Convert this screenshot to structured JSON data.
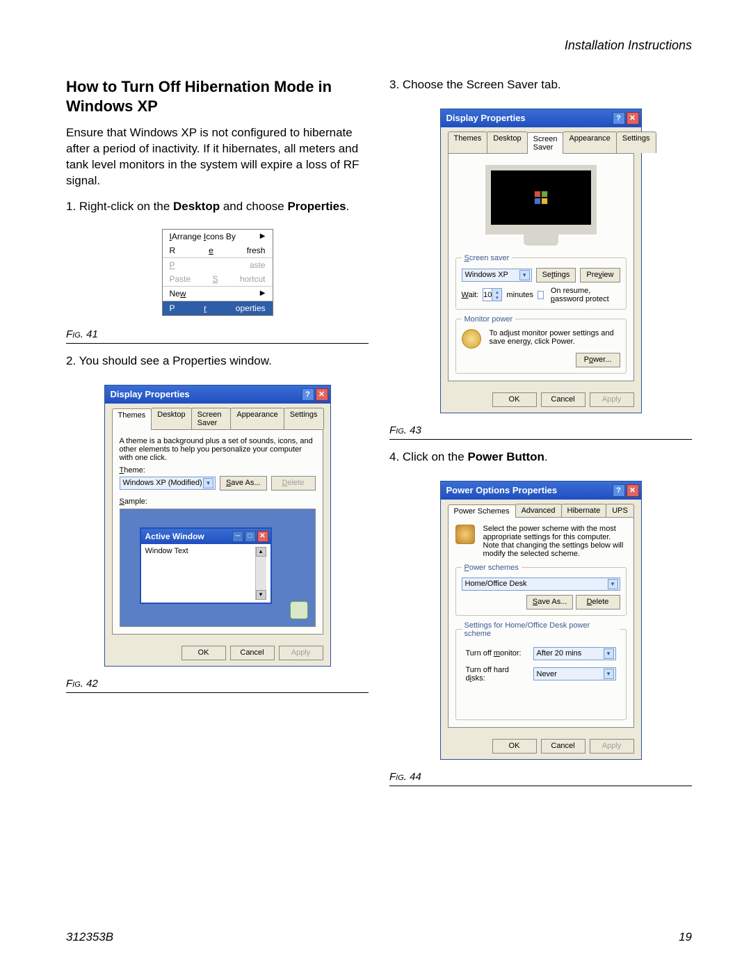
{
  "header": {
    "section": "Installation Instructions"
  },
  "title": "How to Turn Off Hibernation Mode in Windows XP",
  "intro": "Ensure that Windows XP is not configured to hibernate after a period of inactivity. If it hibernates, all meters and tank level monitors in the system will expire a loss of RF signal.",
  "steps": {
    "s1_pre": "1.   Right-click on the ",
    "s1_b1": "Desktop",
    "s1_mid": " and choose ",
    "s1_b2": "Properties",
    "s1_post": ".",
    "s2": "2.   You should see a Properties window.",
    "s3": "3.   Choose the Screen Saver tab.",
    "s4_pre": "4.   Click on the ",
    "s4_b": "Power Button",
    "s4_post": "."
  },
  "fig": {
    "f41": "Fig. 41",
    "f42": "Fig. 42",
    "f43": "Fig. 43",
    "f44": "Fig. 44"
  },
  "ctx": {
    "arrange": "Arrange Icons By",
    "refresh": "Refresh",
    "paste": "Paste",
    "paste_shortcut": "Paste Shortcut",
    "new": "New",
    "properties": "Properties"
  },
  "dlg42": {
    "title": "Display Properties",
    "tabs": [
      "Themes",
      "Desktop",
      "Screen Saver",
      "Appearance",
      "Settings"
    ],
    "desc": "A theme is a background plus a set of sounds, icons, and other elements to help you personalize your computer with one click.",
    "theme_label": "Theme:",
    "theme_value": "Windows XP (Modified)",
    "save_as": "Save As...",
    "delete": "Delete",
    "sample_label": "Sample:",
    "active_window": "Active Window",
    "window_text": "Window Text",
    "ok": "OK",
    "cancel": "Cancel",
    "apply": "Apply"
  },
  "dlg43": {
    "title": "Display Properties",
    "tabs": [
      "Themes",
      "Desktop",
      "Screen Saver",
      "Appearance",
      "Settings"
    ],
    "ss_label": "Screen saver",
    "ss_value": "Windows XP",
    "settings": "Settings",
    "preview": "Preview",
    "wait": "Wait:",
    "wait_val": "10",
    "minutes": "minutes",
    "resume": "On resume, password protect",
    "mp_label": "Monitor power",
    "mp_text": "To adjust monitor power settings and save energy, click Power.",
    "power": "Power...",
    "ok": "OK",
    "cancel": "Cancel",
    "apply": "Apply"
  },
  "dlg44": {
    "title": "Power Options Properties",
    "tabs": [
      "Power Schemes",
      "Advanced",
      "Hibernate",
      "UPS"
    ],
    "desc": "Select the power scheme with the most appropriate settings for this computer. Note that changing the settings below will modify the selected scheme.",
    "ps_label": "Power schemes",
    "ps_value": "Home/Office Desk",
    "save_as": "Save As...",
    "delete": "Delete",
    "settings_for": "Settings for Home/Office Desk power scheme",
    "turn_off_monitor": "Turn off monitor:",
    "turn_off_monitor_val": "After 20 mins",
    "turn_off_hd": "Turn off hard disks:",
    "turn_off_hd_val": "Never",
    "ok": "OK",
    "cancel": "Cancel",
    "apply": "Apply"
  },
  "footer": {
    "doc": "312353B",
    "page": "19"
  }
}
